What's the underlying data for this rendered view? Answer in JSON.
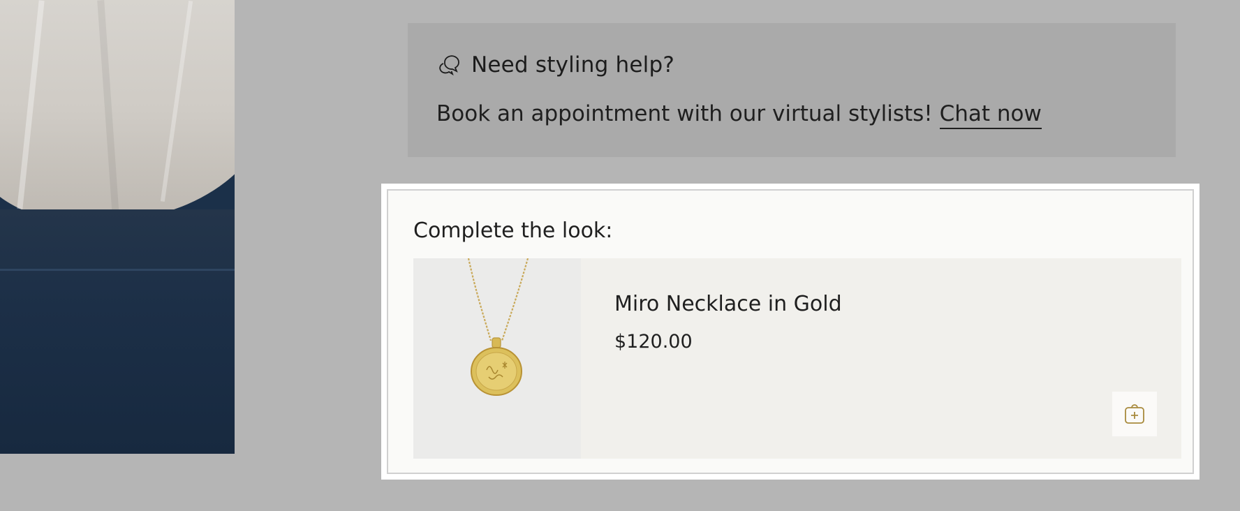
{
  "help": {
    "icon": "chat-bubbles-icon",
    "title": "Need styling help?",
    "text": "Book an appointment with our virtual stylists!",
    "link_label": "Chat now"
  },
  "complete_look": {
    "label": "Complete the look:",
    "product": {
      "image_icon": "gold-coin-necklace",
      "name": "Miro Necklace in Gold",
      "price": "$120.00",
      "add_icon": "add-to-bag-icon"
    }
  },
  "colors": {
    "page_bg": "#b5b5b5",
    "banner_bg": "#aaaaaa",
    "card_bg": "#f1f0ec",
    "thumb_bg": "#ebebea",
    "accent_gold": "#a88a3c",
    "text": "#1f1f1f"
  }
}
